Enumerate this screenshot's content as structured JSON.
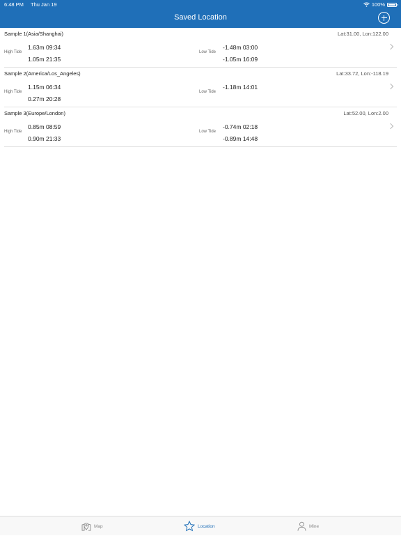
{
  "status_bar": {
    "time": "6:48 PM",
    "date": "Thu Jan 19",
    "battery": "100%"
  },
  "nav": {
    "title": "Saved Location",
    "add_icon": "plus-circle-icon"
  },
  "locations": [
    {
      "name": "Sample 1(Asia/Shanghai)",
      "coords": "Lat:31.00, Lon:122.00",
      "high_label": "High Tide",
      "high": [
        "1.63m 09:34",
        "1.05m 21:35"
      ],
      "low_label": "Low Tide",
      "low": [
        "-1.48m 03:00",
        "-1.05m 16:09"
      ]
    },
    {
      "name": "Sample 2(America/Los_Angeles)",
      "coords": "Lat:33.72, Lon:-118.19",
      "high_label": "High Tide",
      "high": [
        "1.15m 06:34",
        "0.27m 20:28"
      ],
      "low_label": "Low Tide",
      "low": [
        "-1.18m 14:01",
        ""
      ]
    },
    {
      "name": "Sample 3(Europe/London)",
      "coords": "Lat:52.00, Lon:2.00",
      "high_label": "High Tide",
      "high": [
        "0.85m 08:59",
        "0.90m 21:33"
      ],
      "low_label": "Low Tide",
      "low": [
        "-0.74m 02:18",
        "-0.89m 14:48"
      ]
    }
  ],
  "tabs": [
    {
      "label": "Map",
      "icon": "map-pin-icon"
    },
    {
      "label": "Location",
      "icon": "star-icon"
    },
    {
      "label": "Mine",
      "icon": "person-icon"
    }
  ],
  "colors": {
    "accent": "#1f6fb8",
    "inactive": "#8a8a8a"
  }
}
